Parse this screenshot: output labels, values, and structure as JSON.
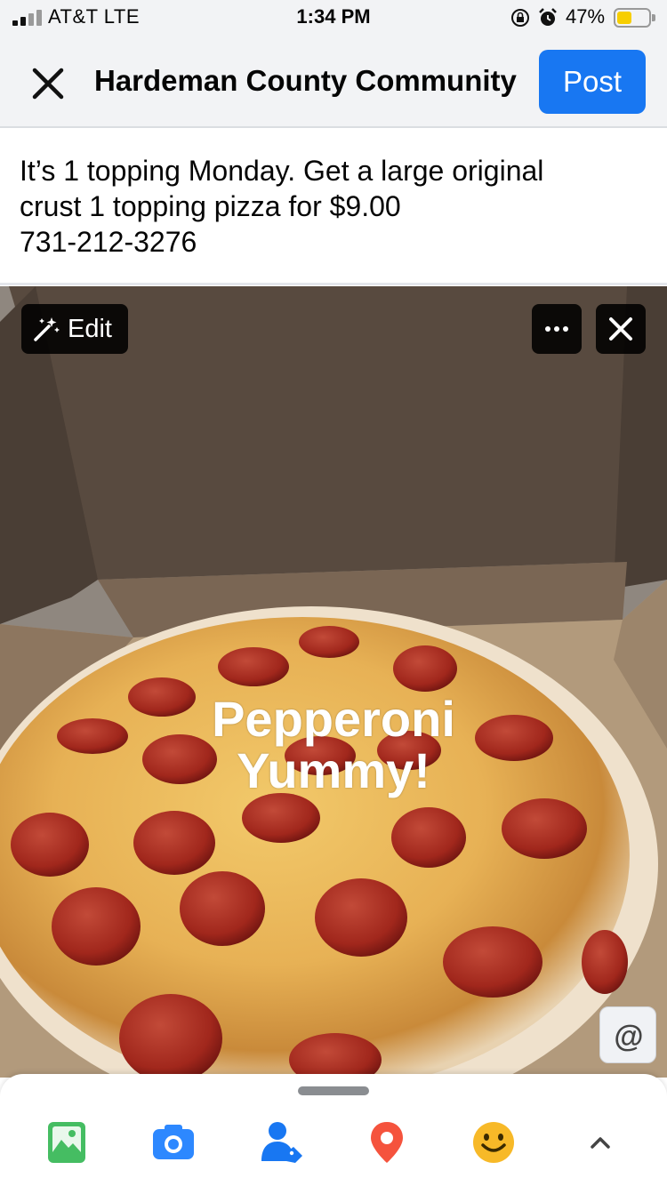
{
  "status_bar": {
    "carrier": "AT&T   LTE",
    "time": "1:34 PM",
    "battery_percent": "47%",
    "signal_bars": 2,
    "battery_level": 0.47
  },
  "header": {
    "title": "Hardeman County Community",
    "post_label": "Post",
    "close_icon": "close-icon"
  },
  "post": {
    "lines": [
      "It’s 1 topping Monday. Get a large original",
      "crust 1 topping pizza for $9.00",
      "731-212-3276"
    ]
  },
  "photo": {
    "edit_label": "Edit",
    "overlay_lines": [
      "Pepperoni",
      "Yummy!"
    ],
    "more_icon": "more-icon",
    "remove_icon": "close-icon",
    "mention_symbol": "@"
  },
  "toolbar": {
    "icons": [
      "photo-icon",
      "camera-icon",
      "tag-people-icon",
      "location-icon",
      "feeling-icon",
      "chevron-up-icon"
    ]
  },
  "colors": {
    "accent": "#1877f2",
    "photo_green": "#45bd62",
    "location_red": "#f5533d",
    "feeling_yellow": "#f7b928",
    "battery_yellow": "#f7ce00"
  }
}
